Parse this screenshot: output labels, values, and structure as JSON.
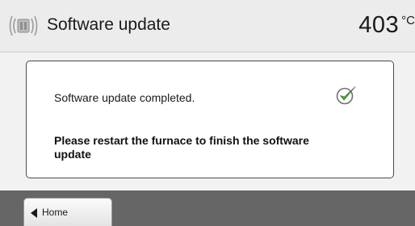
{
  "header": {
    "icon": "furnace-icon",
    "title": "Software update",
    "temperature": "403",
    "temperature_unit": "°C"
  },
  "dialog": {
    "status_text": "Software update completed.",
    "status_icon": "checkmark-icon",
    "instruction_text": "Please restart the furnace to finish the software update"
  },
  "footer": {
    "home_label": "Home",
    "home_icon": "arrow-left-icon"
  },
  "colors": {
    "header_bg": "#ececec",
    "bottom_bar": "#666666",
    "check_green": "#55a047"
  }
}
